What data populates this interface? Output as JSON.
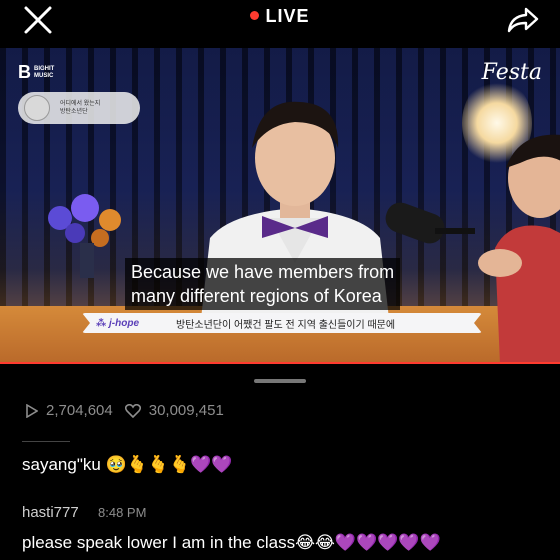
{
  "header": {
    "live_label": "LIVE"
  },
  "video": {
    "brand_logo": "BIGHIT MUSIC",
    "brand_logo_line1": "BIGHIT",
    "brand_logo_line2": "MUSIC",
    "festa_logo": "Festa",
    "chip_text_line1": "어디에서 왔는지",
    "chip_text_line2": "방탄소년단",
    "subtitle_line1": "Because we have members from",
    "subtitle_line2": "many different regions of Korea",
    "caption_name": "j-hope",
    "caption_text": "방탄소년단이 어쨌건 팔도 전 지역 출신들이기 때문에"
  },
  "stats": {
    "views": "2,704,604",
    "likes": "30,009,451"
  },
  "comments": [
    {
      "text": "sayang\"ku 🥹🫰🫰🫰💜💜"
    },
    {
      "user": "hasti777",
      "time": "8:48 PM",
      "text": "please speak lower I am in the class😂😂💜💜💜💜💜"
    }
  ],
  "colors": {
    "live_dot": "#ff3b2f",
    "progress": "#ff3b2f",
    "muted_text": "#8d8d8d"
  },
  "icons": [
    "close-icon",
    "share-icon",
    "play-icon",
    "heart-icon"
  ]
}
